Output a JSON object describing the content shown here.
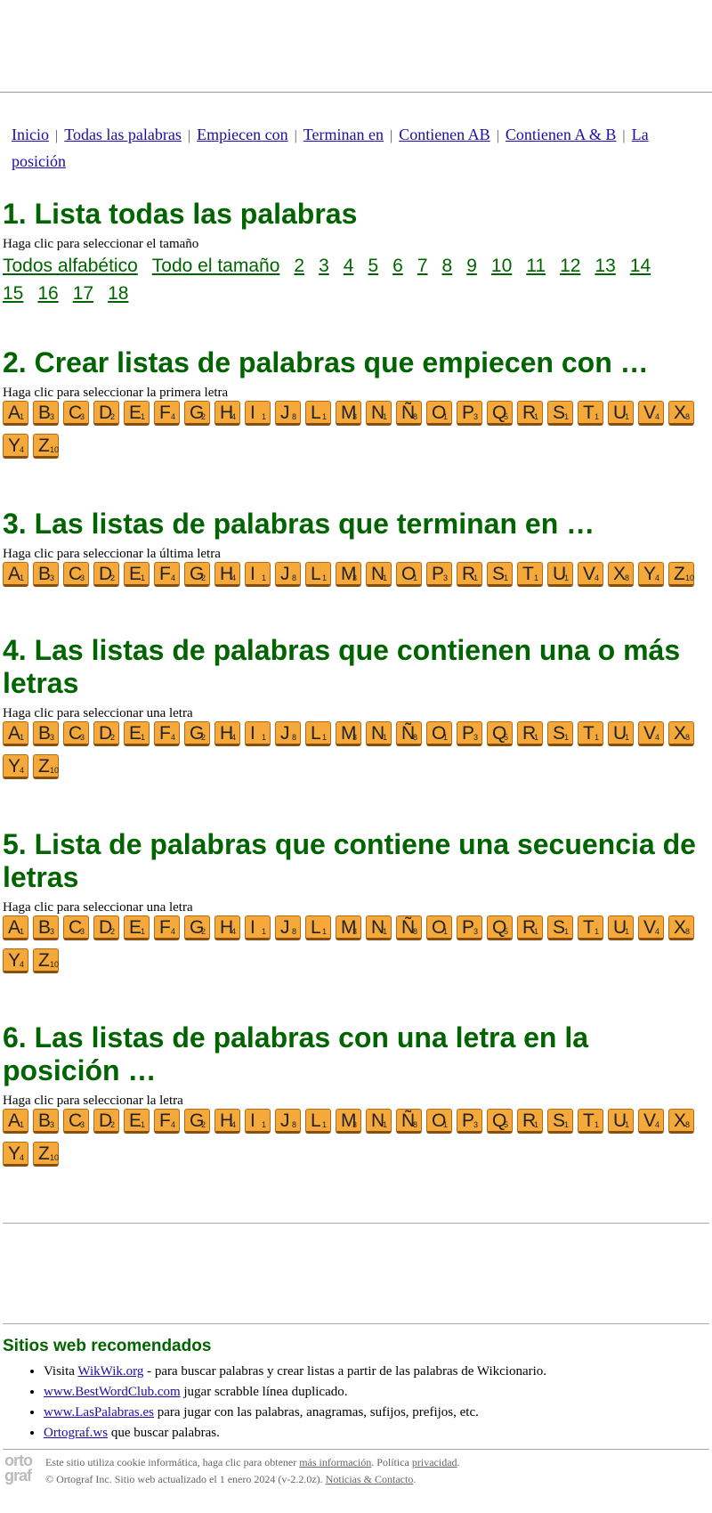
{
  "nav": {
    "items": [
      {
        "label": "Inicio"
      },
      {
        "label": "Todas las palabras"
      },
      {
        "label": "Empiecen con"
      },
      {
        "label": "Terminan en"
      },
      {
        "label": "Contienen AB"
      },
      {
        "label": "Contienen A & B"
      },
      {
        "label": "La posición"
      }
    ],
    "separator": "|"
  },
  "section1": {
    "title": "1. Lista todas las palabras",
    "hint": "Haga clic para seleccionar el tamaño",
    "sizes": [
      "Todos alfabético",
      "Todo el tamaño",
      "2",
      "3",
      "4",
      "5",
      "6",
      "7",
      "8",
      "9",
      "10",
      "11",
      "12",
      "13",
      "14",
      "15",
      "16",
      "17",
      "18"
    ]
  },
  "section2": {
    "title": "2. Crear listas de palabras que empiecen con …",
    "hint": "Haga clic para seleccionar la primera letra"
  },
  "section3": {
    "title": "3. Las listas de palabras que terminan en …",
    "hint": "Haga clic para seleccionar la última letra"
  },
  "section4": {
    "title": "4. Las listas de palabras que contienen una o más letras",
    "hint": "Haga clic para seleccionar una letra"
  },
  "section5": {
    "title": "5. Lista de palabras que contiene una secuencia de letras",
    "hint": "Haga clic para seleccionar una letra"
  },
  "section6": {
    "title": "6. Las listas de palabras con una letra en la posición …",
    "hint": "Haga clic para seleccionar la letra"
  },
  "tiles_full": [
    {
      "l": "A",
      "p": "1"
    },
    {
      "l": "B",
      "p": "3"
    },
    {
      "l": "C",
      "p": "3"
    },
    {
      "l": "D",
      "p": "2"
    },
    {
      "l": "E",
      "p": "1"
    },
    {
      "l": "F",
      "p": "4"
    },
    {
      "l": "G",
      "p": "2"
    },
    {
      "l": "H",
      "p": "4"
    },
    {
      "l": "I",
      "p": "1"
    },
    {
      "l": "J",
      "p": "8"
    },
    {
      "l": "L",
      "p": "1"
    },
    {
      "l": "M",
      "p": "3"
    },
    {
      "l": "N",
      "p": "1"
    },
    {
      "l": "Ñ",
      "p": "8"
    },
    {
      "l": "O",
      "p": "1"
    },
    {
      "l": "P",
      "p": "3"
    },
    {
      "l": "Q",
      "p": "5"
    },
    {
      "l": "R",
      "p": "1"
    },
    {
      "l": "S",
      "p": "1"
    },
    {
      "l": "T",
      "p": "1"
    },
    {
      "l": "U",
      "p": "1"
    },
    {
      "l": "V",
      "p": "4"
    },
    {
      "l": "X",
      "p": "8"
    },
    {
      "l": "Y",
      "p": "4"
    },
    {
      "l": "Z",
      "p": "10"
    }
  ],
  "tiles_end": [
    {
      "l": "A",
      "p": "1"
    },
    {
      "l": "B",
      "p": "3"
    },
    {
      "l": "C",
      "p": "3"
    },
    {
      "l": "D",
      "p": "2"
    },
    {
      "l": "E",
      "p": "1"
    },
    {
      "l": "F",
      "p": "4"
    },
    {
      "l": "G",
      "p": "2"
    },
    {
      "l": "H",
      "p": "4"
    },
    {
      "l": "I",
      "p": "1"
    },
    {
      "l": "J",
      "p": "8"
    },
    {
      "l": "L",
      "p": "1"
    },
    {
      "l": "M",
      "p": "3"
    },
    {
      "l": "N",
      "p": "1"
    },
    {
      "l": "O",
      "p": "1"
    },
    {
      "l": "P",
      "p": "3"
    },
    {
      "l": "R",
      "p": "1"
    },
    {
      "l": "S",
      "p": "1"
    },
    {
      "l": "T",
      "p": "1"
    },
    {
      "l": "U",
      "p": "1"
    },
    {
      "l": "V",
      "p": "4"
    },
    {
      "l": "X",
      "p": "8"
    },
    {
      "l": "Y",
      "p": "4"
    },
    {
      "l": "Z",
      "p": "10"
    }
  ],
  "recommended": {
    "title": "Sitios web recomendados",
    "items": [
      {
        "prefix": "Visita ",
        "link": "WikWik.org",
        "suffix": " - para buscar palabras y crear listas a partir de las palabras de Wikcionario."
      },
      {
        "prefix": "",
        "link": "www.BestWordClub.com",
        "suffix": " jugar scrabble línea duplicado."
      },
      {
        "prefix": "",
        "link": "www.LasPalabras.es",
        "suffix": " para jugar con las palabras, anagramas, sufijos, prefijos, etc."
      },
      {
        "prefix": "",
        "link": "Ortograf.ws",
        "suffix": " que buscar palabras."
      }
    ]
  },
  "footer": {
    "logo_top": "orto",
    "logo_bottom": "graf",
    "cookie_text": "Este sitio utiliza cookie informática, haga clic para obtener ",
    "cookie_link": "más información",
    "policy_text": ". Política ",
    "policy_link": "privacidad",
    "policy_end": ".",
    "copyright": "© Ortograf Inc. Sitio web actualizado el 1 enero 2024 (v-2.2.0z). ",
    "contact_link": "Noticias & Contacto",
    "contact_end": "."
  }
}
